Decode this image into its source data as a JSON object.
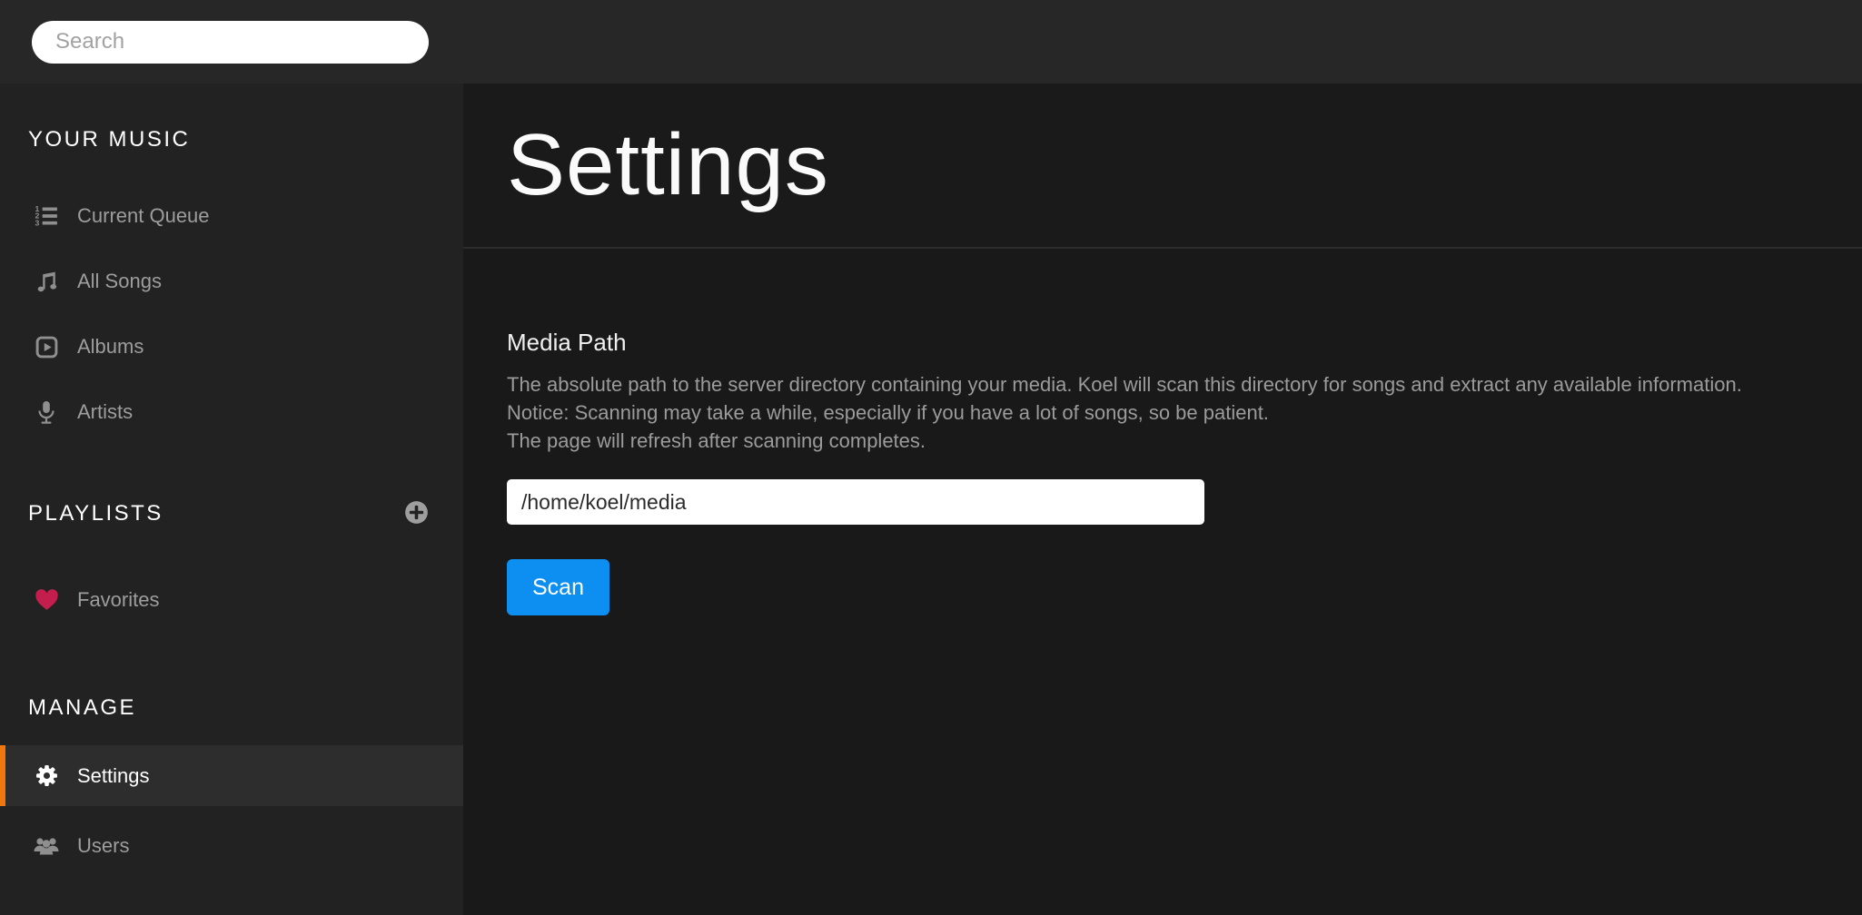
{
  "header": {
    "search": {
      "placeholder": "Search",
      "icon": "none"
    }
  },
  "sidebar": {
    "sections": [
      {
        "title": "YOUR MUSIC",
        "items": [
          {
            "label": "Current Queue",
            "icon": "queue-list-icon",
            "active": false
          },
          {
            "label": "All Songs",
            "icon": "music-note-icon",
            "active": false
          },
          {
            "label": "Albums",
            "icon": "play-square-icon",
            "active": false
          },
          {
            "label": "Artists",
            "icon": "microphone-icon",
            "active": false
          }
        ]
      },
      {
        "title": "PLAYLISTS",
        "add_button_icon": "plus-circle-icon",
        "items": [
          {
            "label": "Favorites",
            "icon": "heart-icon",
            "active": false
          }
        ]
      },
      {
        "title": "MANAGE",
        "items": [
          {
            "label": "Settings",
            "icon": "gear-icon",
            "active": true
          },
          {
            "label": "Users",
            "icon": "users-icon",
            "active": false
          }
        ]
      }
    ]
  },
  "main": {
    "title": "Settings",
    "media_path": {
      "heading": "Media Path",
      "description_lines": [
        "The absolute path to the server directory containing your media. Koel will scan this directory for songs and extract any available information.",
        "Notice: Scanning may take a while, especially if you have a lot of songs, so be patient.",
        "The page will refresh after scanning completes."
      ],
      "input_value": "/home/koel/media",
      "scan_label": "Scan"
    }
  },
  "colors": {
    "accent_orange": "#f0760d",
    "heart_red": "#c31e4d",
    "scan_blue": "#0d8ff2",
    "header_bg": "#272727",
    "sidebar_bg": "#222222",
    "content_bg": "#191919",
    "active_item_bg": "#2d2d2d"
  }
}
